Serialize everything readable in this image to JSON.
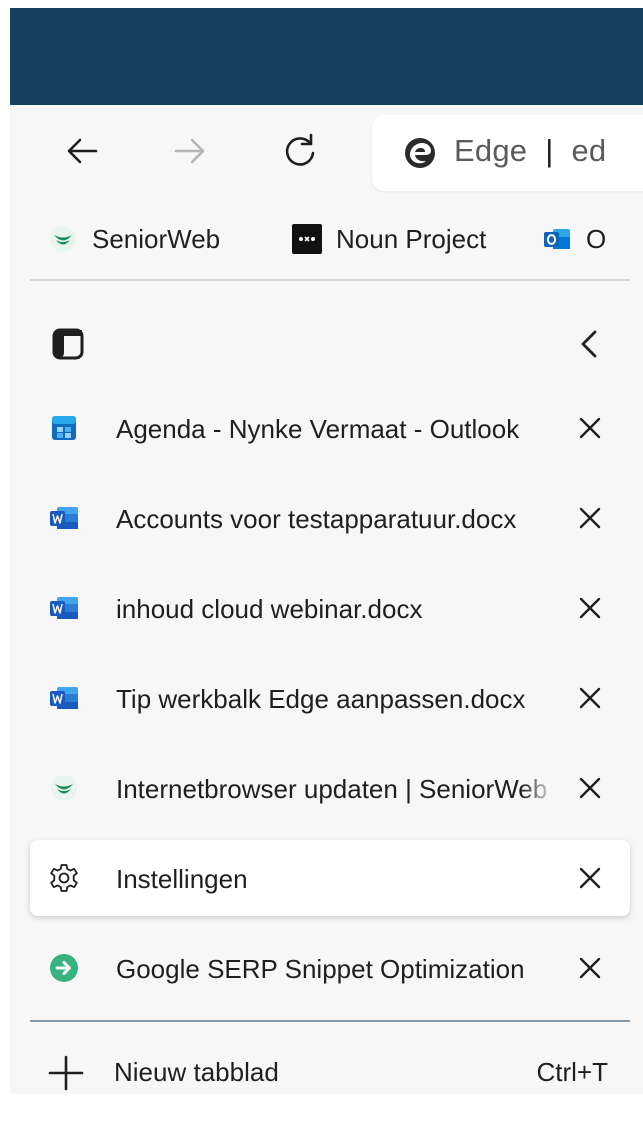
{
  "browser": {
    "address_bar": {
      "site_label": "Edge",
      "separator": "|",
      "url_fragment": "ed"
    },
    "icons": {
      "back": "arrow-left-icon",
      "forward": "arrow-right-icon",
      "refresh": "refresh-icon",
      "site": "edge-logo-icon"
    }
  },
  "favorites": [
    {
      "label": "SeniorWeb",
      "icon": "seniorweb-icon"
    },
    {
      "label": "Noun Project",
      "icon": "noun-project-icon"
    },
    {
      "label": "O",
      "icon": "outlook-icon"
    }
  ],
  "vertical_tabs": {
    "header_icons": {
      "layout": "tab-layout-icon",
      "collapse": "chevron-left-icon"
    },
    "tabs": [
      {
        "title": "Agenda - Nynke Vermaat - Outlook",
        "icon": "outlook-calendar-icon",
        "active": false
      },
      {
        "title": "Accounts voor testapparatuur.docx",
        "icon": "word-icon",
        "active": false
      },
      {
        "title": "inhoud cloud webinar.docx",
        "icon": "word-icon",
        "active": false
      },
      {
        "title": "Tip werkbalk Edge aanpassen.docx",
        "icon": "word-icon",
        "active": false
      },
      {
        "title": "Internetbrowser updaten | SeniorWeb",
        "icon": "seniorweb-icon",
        "active": false
      },
      {
        "title": "Instellingen",
        "icon": "gear-icon",
        "active": true
      },
      {
        "title": "Google SERP Snippet Optimization",
        "icon": "arrow-circle-icon",
        "active": false
      }
    ],
    "new_tab": {
      "label": "Nieuw tabblad",
      "shortcut": "Ctrl+T",
      "icon": "plus-icon"
    }
  },
  "colors": {
    "titlebar": "#14425e",
    "panel_background": "#f7f7f7",
    "seniorweb_green": "#1c8b5c",
    "word_blue": "#185abd",
    "snippet_green": "#36b37e"
  }
}
